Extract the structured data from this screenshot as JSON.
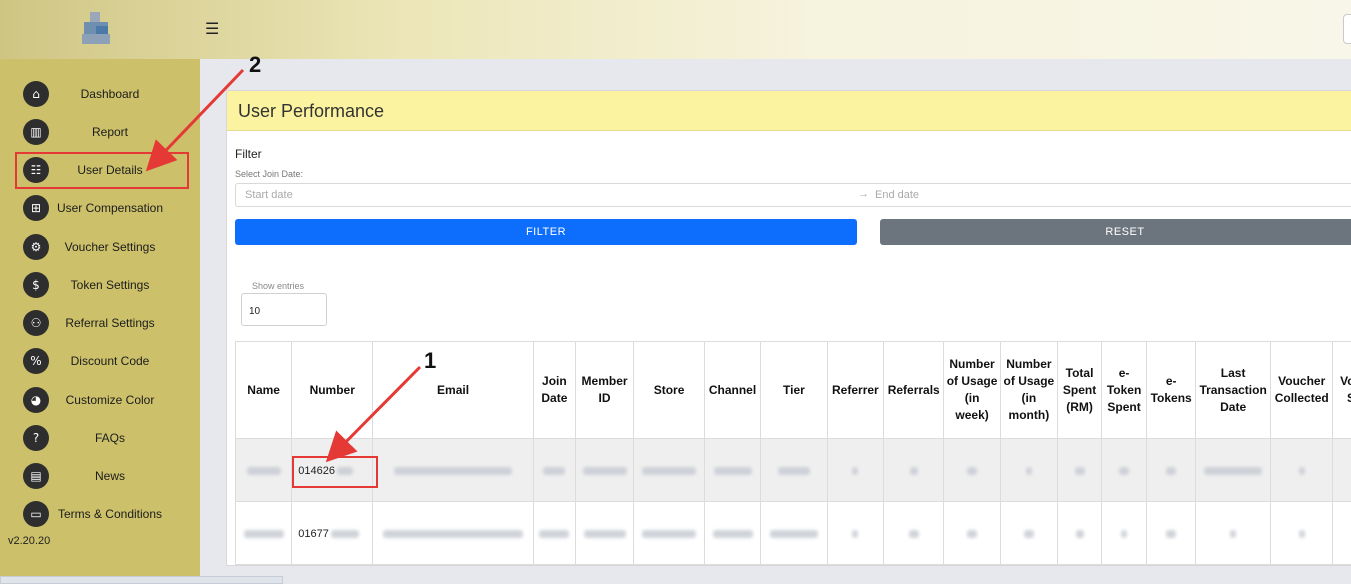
{
  "header": {
    "menu_icon": "☰"
  },
  "sidebar": {
    "items": [
      {
        "label": "Dashboard",
        "icon": "home-icon",
        "glyph": "⌂"
      },
      {
        "label": "Report",
        "icon": "report-icon",
        "glyph": "▥"
      },
      {
        "label": "User Details",
        "icon": "user-card-icon",
        "glyph": "☷"
      },
      {
        "label": "User Compensation",
        "icon": "gift-icon",
        "glyph": "⊞"
      },
      {
        "label": "Voucher Settings",
        "icon": "gear-icon",
        "glyph": "⚙"
      },
      {
        "label": "Token Settings",
        "icon": "coin-icon",
        "glyph": "$"
      },
      {
        "label": "Referral Settings",
        "icon": "users-icon",
        "glyph": "⚇"
      },
      {
        "label": "Discount Code",
        "icon": "percent-icon",
        "glyph": "%"
      },
      {
        "label": "Customize Color",
        "icon": "palette-icon",
        "glyph": "◕"
      },
      {
        "label": "FAQs",
        "icon": "question-icon",
        "glyph": "?"
      },
      {
        "label": "News",
        "icon": "news-icon",
        "glyph": "▤"
      },
      {
        "label": "Terms & Conditions",
        "icon": "document-icon",
        "glyph": "▭"
      }
    ],
    "version": "v2.20.20"
  },
  "main": {
    "title": "User Performance",
    "filter_label": "Filter",
    "join_date_label": "Select Join Date:",
    "start_placeholder": "Start date",
    "end_placeholder": "End date",
    "range_arrow": "→",
    "filter_button": "FILTER",
    "reset_button": "RESET",
    "entries_label": "Show entries",
    "entries_value": "10"
  },
  "table": {
    "columns": [
      "Name",
      "Number",
      "Email",
      "Join Date",
      "Member ID",
      "Store",
      "Channel",
      "Tier",
      "Referrer",
      "Referrals",
      "Number of Usage (in week)",
      "Number of Usage (in month)",
      "Total Spent (RM)",
      "e-Token Spent",
      "e-Tokens",
      "Last Transaction Date",
      "Voucher Collected",
      "Voucher Spent"
    ],
    "rows": [
      {
        "number": "014626"
      },
      {
        "number": "01677"
      }
    ]
  },
  "annotations": {
    "label_1": "1",
    "label_2": "2",
    "color": "#e53935"
  }
}
